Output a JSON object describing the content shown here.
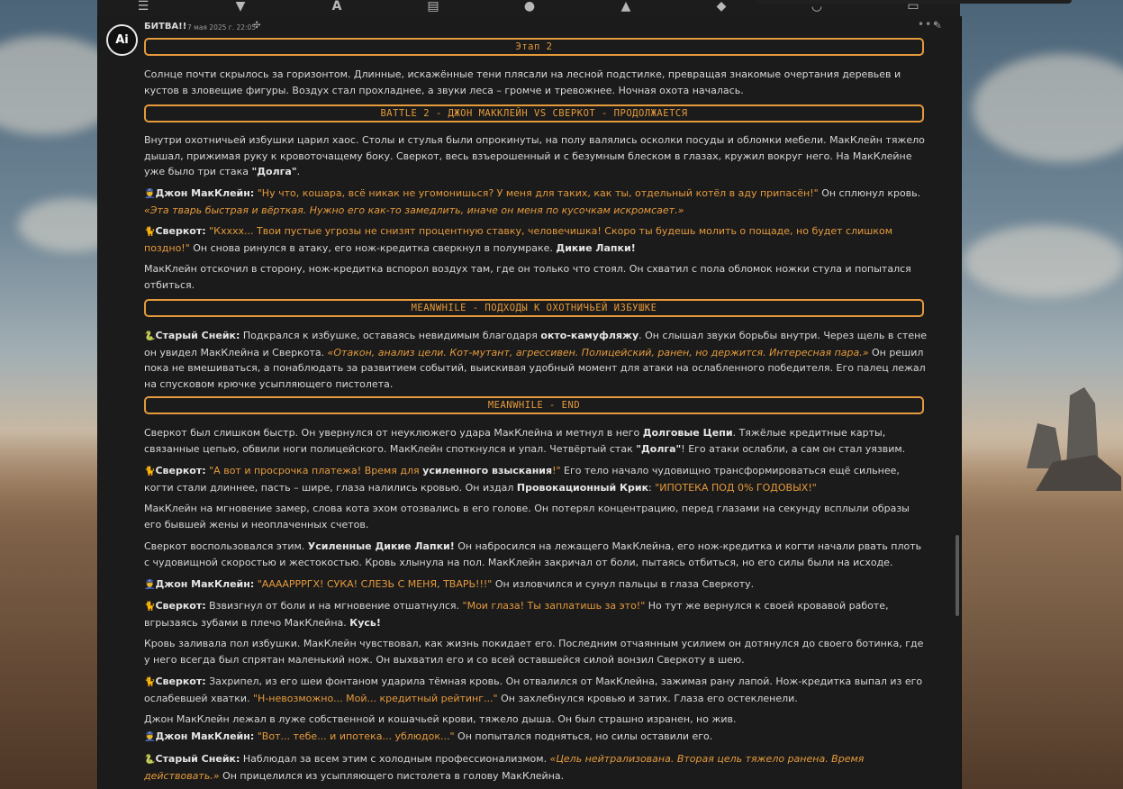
{
  "post": {
    "author": "БИТВА!!",
    "date": "7 мая 2025 г. 22:05",
    "avatar_text": "Ai"
  },
  "toolbar": {
    "icons": [
      "sliders-icon",
      "bell-icon",
      "font-icon",
      "book-icon",
      "user-settings-icon",
      "image-icon",
      "cubes-icon",
      "smile-icon",
      "id-card-icon"
    ]
  },
  "sections": {
    "s1": "Этап 2",
    "s2": "BATTLE 2 - ДЖОН МАККЛЕЙН VS СВЕРКОТ - ПРОДОЛЖАЕТСЯ",
    "s3": "MEANWHILE - ПОДХОДЫ К ОХОТНИЧЬЕЙ ИЗБУШКЕ",
    "s4": "MEANWHILE - END"
  },
  "paragraphs": {
    "p1": "Солнце почти скрылось за горизонтом. Длинные, искажённые тени плясали на лесной подстилке, превращая знакомые очертания деревьев и кустов в зловещие фигуры. Воздух стал прохладнее, а звуки леса – громче и тревожнее. Ночная охота началась.",
    "p2a": "Внутри охотничьей избушки царил хаос. Столы и стулья были опрокинуты, на полу валялись осколки посуды и обломки мебели. МакКлейн тяжело дышал, прижимая руку к кровоточащему боку. Сверкот, весь взъерошенный и с безумным блеском в глазах, кружил вокруг него. На МакКлейне уже было три стака ",
    "p2b": "\"Долга\"",
    "p2c": ".",
    "p3a": "Джон МакКлейн:",
    "p3b": "\"Ну что, кошара, всё никак не угомонишься? У меня для таких, как ты, отдельный котёл в аду припасён!\"",
    "p3c": " Он сплюнул кровь. ",
    "p3d": "«Эта тварь быстрая и вёрткая. Нужно его как-то замедлить, иначе он меня по кусочкам искромсает.»",
    "p4a": "Сверкот:",
    "p4b": "\"Кхххх... Твои пустые угрозы не снизят процентную ставку, человечишка! Скоро ты будешь молить о пощаде, но будет слишком поздно!\"",
    "p4c": " Он снова ринулся в атаку, его нож-кредитка сверкнул в полумраке. ",
    "p4d": "Дикие Лапки!",
    "p5": "МакКлейн отскочил в сторону, нож-кредитка вспорол воздух там, где он только что стоял. Он схватил с пола обломок ножки стула и попытался отбиться.",
    "p6a": "Старый Снейк:",
    "p6b": " Подкрался к избушке, оставаясь невидимым благодаря ",
    "p6c": "окто-камуфляжу",
    "p6d": ". Он слышал звуки борьбы внутри. Через щель в стене он увидел МакКлейна и Сверкота. ",
    "p6e": "«Отакон, анализ цели. Кот-мутант, агрессивен. Полицейский, ранен, но держится. Интересная пара.»",
    "p6f": " Он решил пока не вмешиваться, а понаблюдать за развитием событий, выискивая удобный момент для атаки на ослабленного победителя. Его палец лежал на спусковом крючке усыпляющего пистолета.",
    "p7a": "Сверкот был слишком быстр. Он увернулся от неуклюжего удара МакКлейна и метнул в него ",
    "p7b": "Долговые Цепи",
    "p7c": ". Тяжёлые кредитные карты, связанные цепью, обвили ноги полицейского. МакКлейн споткнулся и упал. Четвёртый стак ",
    "p7d": "\"Долга\"",
    "p7e": "! Его атаки ослабли, а сам он стал уязвим.",
    "p8a": "Сверкот:",
    "p8b": "\"А вот и просрочка платежа! Время для ",
    "p8c": "усиленного взыскания",
    "p8d": "!\"",
    "p8e": " Его тело начало чудовищно трансформироваться ещё сильнее, когти стали длиннее, пасть – шире, глаза налились кровью. Он издал ",
    "p8f": "Провокационный Крик",
    "p8g": ": ",
    "p8h": "\"ИПОТЕКА ПОД 0% ГОДОВЫХ!\"",
    "p9": "МакКлейн на мгновение замер, слова кота эхом отозвались в его голове. Он потерял концентрацию, перед глазами на секунду всплыли образы его бывшей жены и неоплаченных счетов.",
    "p10a": "Сверкот воспользовался этим. ",
    "p10b": "Усиленные Дикие Лапки!",
    "p10c": " Он набросился на лежащего МакКлейна, его нож-кредитка и когти начали рвать плоть с чудовищной скоростью и жестокостью. Кровь хлынула на пол. МакКлейн закричал от боли, пытаясь отбиться, но его силы были на исходе.",
    "p11a": "Джон МакКлейн:",
    "p11b": "\"ААААРРРГХ! СУКА! СЛЕЗЬ С МЕНЯ, ТВАРЬ!!!\"",
    "p11c": " Он изловчился и сунул пальцы в глаза Сверкоту.",
    "p12a": "Сверкот:",
    "p12b": " Взвизгнул от боли и на мгновение отшатнулся. ",
    "p12c": "\"Мои глаза! Ты заплатишь за это!\"",
    "p12d": " Но тут же вернулся к своей кровавой работе, вгрызаясь зубами в плечо МакКлейна. ",
    "p12e": "Кусь!",
    "p13": "Кровь заливала пол избушки. МакКлейн чувствовал, как жизнь покидает его. Последним отчаянным усилием он дотянулся до своего ботинка, где у него всегда был спрятан маленький нож. Он выхватил его и со всей оставшейся силой вонзил Сверкоту в шею.",
    "p14a": "Сверкот:",
    "p14b": " Захрипел, из его шеи фонтаном ударила тёмная кровь. Он отвалился от МакКлейна, зажимая рану лапой. Нож-кредитка выпал из его ослабевшей хватки. ",
    "p14c": "\"Н-невозможно... Мой... кредитный рейтинг...\"",
    "p14d": " Он захлебнулся кровью и затих. Глаза его остекленели.",
    "p15": "Джон МакКлейн лежал в луже собственной и кошачьей крови, тяжело дыша. Он был страшно изранен, но жив.",
    "p16a": "Джон МакКлейн:",
    "p16b": "\"Вот... тебе... и ипотека... ублюдок...\"",
    "p16c": " Он попытался подняться, но силы оставили его.",
    "p17a": "Старый Снейк:",
    "p17b": " Наблюдал за всем этим с холодным профессионализмом. ",
    "p17c": "«Цель нейтрализована. Вторая цель тяжело ранена. Время действовать.»",
    "p17d": " Он прицелился из усыпляющего пистолета в голову МакКлейна."
  },
  "colors": {
    "accent": "#e59a3c",
    "panel": "#1b1b1b",
    "text": "#d7d7d7"
  }
}
